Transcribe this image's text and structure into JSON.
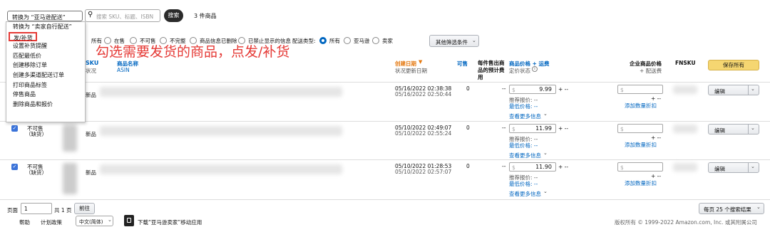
{
  "topbar": {
    "action_select": "转换为 “亚马逊配送”",
    "search_placeholder": "搜索 SKU、标题、ISBN",
    "search_button": "搜索",
    "result_count": "3 件商品"
  },
  "action_menu": {
    "items": [
      "转换为 “卖家自行配送”",
      "发/补货",
      "设置补货提醒",
      "匹配最低价",
      "创建移除订单",
      "创建多渠道配送订单",
      "打印商品标签",
      "停售商品",
      "删除商品和报价"
    ]
  },
  "annotation": {
    "text": "勾选需要发货的商品，点发/补货",
    "color": "#e53935"
  },
  "filters": {
    "status_label": "所有",
    "status_options": [
      "在售",
      "不可售",
      "不完整",
      "商品信息已删除",
      "已禁止显示的信息"
    ],
    "fulfillment_label": "配送类型:",
    "fulfillment_options": [
      "所有",
      "亚马逊",
      "卖家"
    ],
    "more_filters": "其他筛选条件"
  },
  "table": {
    "headers": {
      "sku": "SKU",
      "status": "状况",
      "name": "商品名称",
      "asin": "ASIN",
      "created": "创建日期",
      "updated": "状况更新日期",
      "available": "可售",
      "fee_preview": "每件售出商品的预计费用",
      "price": "商品价格 + 运费",
      "price_status": "定价状态",
      "business_price": "企业商品价格",
      "business_shipping": "+ 配送费",
      "fnsku": "FNSKU",
      "save_all": "保存所有"
    },
    "rows": [
      {
        "status": "",
        "condition": "新品",
        "created": "05/16/2022 02:38:38",
        "updated": "05/16/2022 02:50:44",
        "available": "0",
        "fee": "--",
        "price": "9.99",
        "business_price": ""
      },
      {
        "status": "不可售",
        "status2": "（缺货）",
        "condition": "新品",
        "created": "05/10/2022 02:49:07",
        "updated": "05/10/2022 02:55:24",
        "available": "0",
        "fee": "--",
        "price": "11.99",
        "business_price": ""
      },
      {
        "status": "不可售",
        "status2": "（缺货）",
        "condition": "新品",
        "created": "05/10/2022 01:28:53",
        "updated": "05/10/2022 02:57:07",
        "available": "0",
        "fee": "--",
        "price": "11.90",
        "business_price": ""
      }
    ],
    "currency": "$",
    "shipping_plus": "+ --",
    "recommended_price": "推荐报价:  --",
    "lowest_price": "最低价格:  --",
    "more_info": "查看更多信息",
    "add_quantity_discount": "添加数量折扣",
    "edit_button": "编辑"
  },
  "pagination": {
    "page_label": "页面",
    "page_value": "1",
    "total_pages": "共 1 页",
    "go_button": "前往",
    "per_page": "每页 25 个搜索结果"
  },
  "footer": {
    "help": "帮助",
    "policy": "计划政策",
    "language": "中文(简体)",
    "app_download": "下载“亚马逊卖家”移动应用",
    "copyright": "版权所有 © 1999-2022 Amazon.com, Inc. 或其附属公司"
  }
}
